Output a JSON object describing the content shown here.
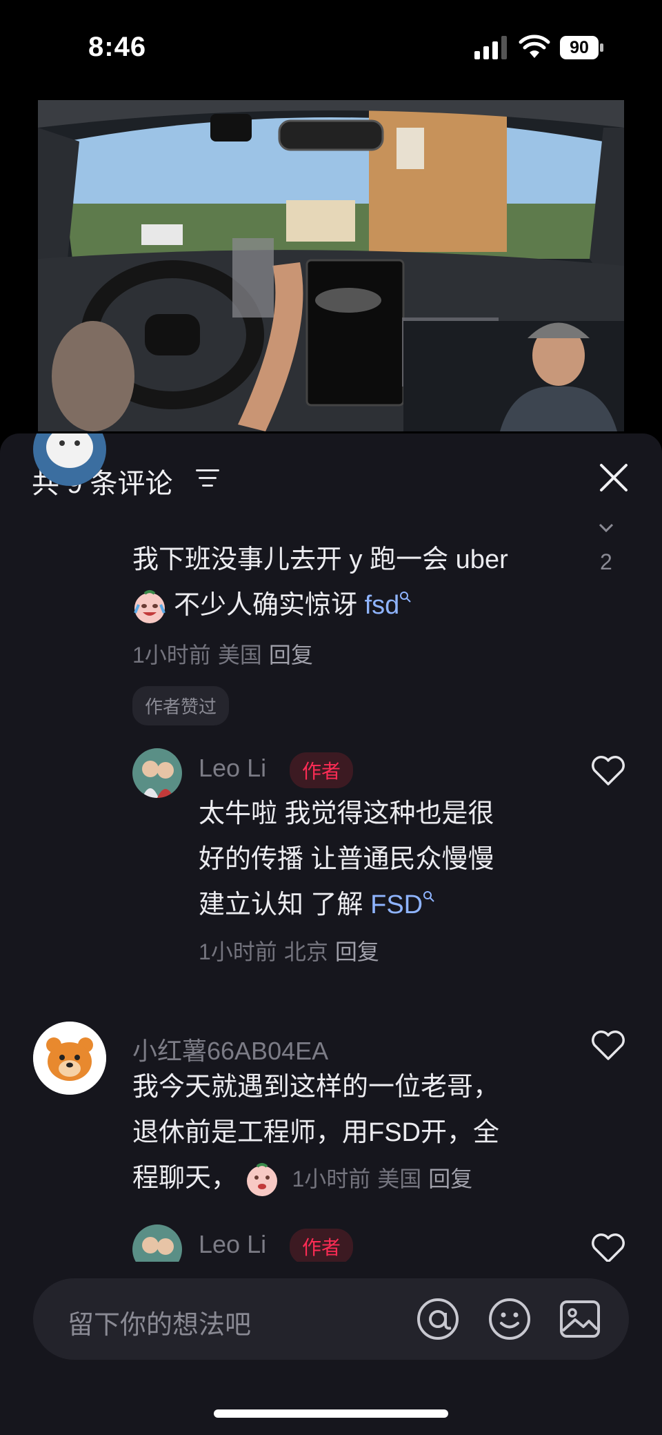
{
  "status_bar": {
    "time": "8:46",
    "battery": "90"
  },
  "comments_header": {
    "title": "共 9 条评论"
  },
  "comments": [
    {
      "text_line1": "我下班没事儿去开 y 跑一会 uber",
      "text_line2": "不少人确实惊讶",
      "link": "fsd",
      "meta_time": "1小时前",
      "meta_location": "美国",
      "reply_label": "回复",
      "like_count": "2",
      "author_liked_chip": "作者赞过",
      "reply": {
        "name": "Leo Li",
        "badge": "作者",
        "line1": "太牛啦 我觉得这种也是很",
        "line2": "好的传播 让普通民众慢慢",
        "line3": "建立认知 了解",
        "link": "FSD",
        "meta_time": "1小时前",
        "meta_location": "北京",
        "reply_label": "回复"
      }
    },
    {
      "name": "小红薯66AB04EA",
      "line1": "我今天就遇到这样的一位老哥，",
      "line2": "退休前是工程师，用FSD开，全",
      "line3": "程聊天，",
      "meta_time": "1小时前",
      "meta_location": "美国",
      "reply_label": "回复",
      "reply": {
        "name": "Leo Li",
        "badge": "作者"
      }
    }
  ],
  "input": {
    "placeholder": "留下你的想法吧"
  },
  "icons": [
    "sort-icon",
    "close-icon",
    "heart-icon",
    "at-icon",
    "emoji-icon",
    "image-icon",
    "search-icon"
  ],
  "colors": {
    "sheet_bg": "#16161d",
    "author_badge": "#fe2c55",
    "link": "#8fb4ff"
  }
}
